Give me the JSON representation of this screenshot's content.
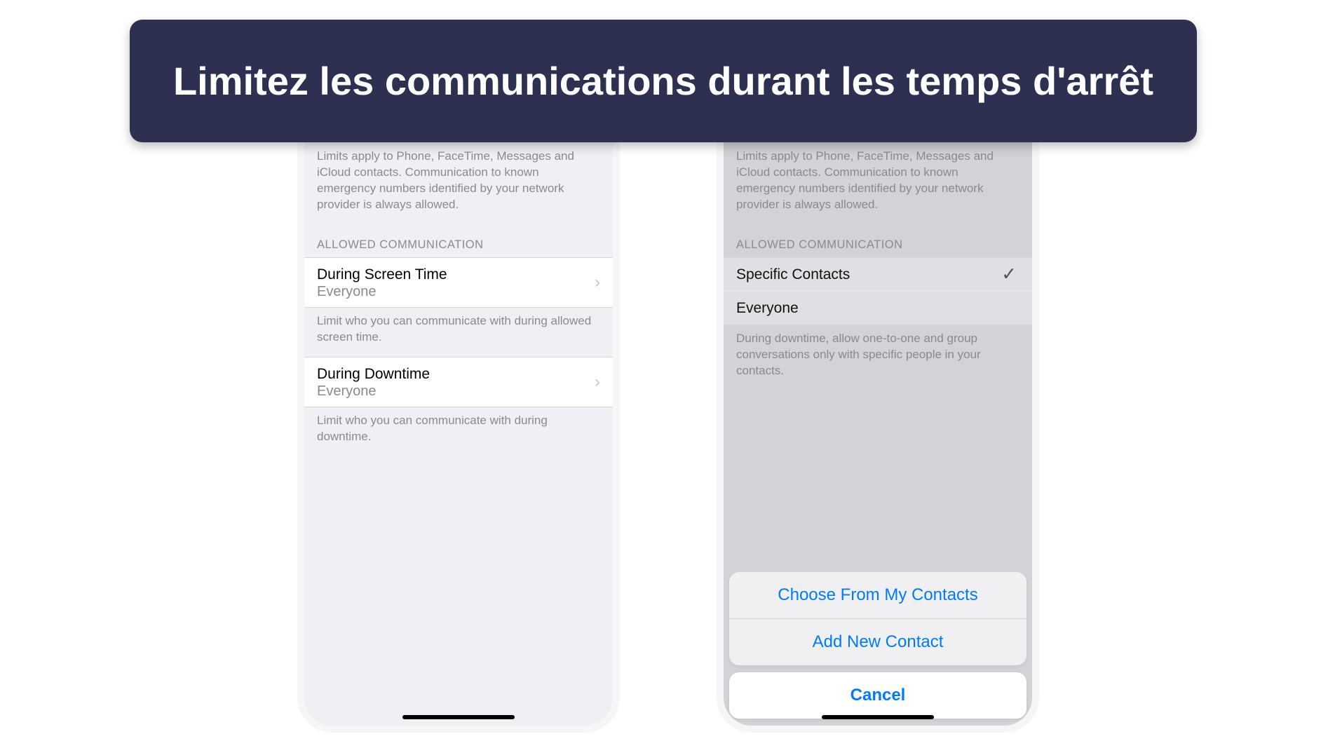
{
  "banner": {
    "title": "Limitez les communications durant les temps d'arrêt"
  },
  "phone_left": {
    "desc": "Limits apply to Phone, FaceTime, Messages and iCloud contacts. Communication to known emergency numbers identified by your network provider is always allowed.",
    "section_header": "ALLOWED COMMUNICATION",
    "cells": [
      {
        "title": "During Screen Time",
        "sub": "Everyone"
      },
      {
        "title": "During Downtime",
        "sub": "Everyone"
      }
    ],
    "footnote_1": "Limit who you can communicate with during allowed screen time.",
    "footnote_2": "Limit who you can communicate with during downtime."
  },
  "phone_right": {
    "desc": "Limits apply to Phone, FaceTime, Messages and iCloud contacts. Communication to known emergency numbers identified by your network provider is always allowed.",
    "section_header": "ALLOWED COMMUNICATION",
    "options": [
      {
        "title": "Specific Contacts",
        "selected": true
      },
      {
        "title": "Everyone",
        "selected": false
      }
    ],
    "footnote": "During downtime, allow one-to-one and group conversations only with specific people in your contacts.",
    "sheet": {
      "choose": "Choose From My Contacts",
      "add": "Add New Contact",
      "cancel": "Cancel"
    }
  }
}
